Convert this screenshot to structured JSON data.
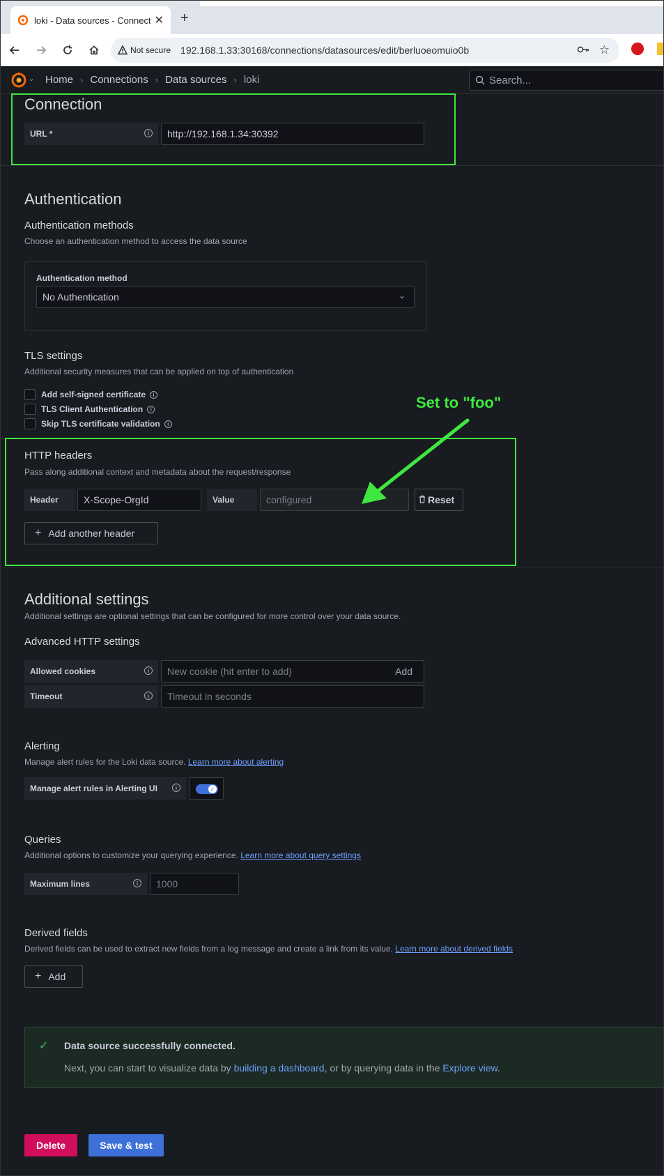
{
  "browser": {
    "tab_title": "loki - Data sources - Connection",
    "url": "192.168.1.33:30168/connections/datasources/edit/berluoeomuio0b",
    "not_secure": "Not secure"
  },
  "header": {
    "breadcrumbs": [
      "Home",
      "Connections",
      "Data sources",
      "loki"
    ],
    "search_placeholder": "Search..."
  },
  "connection": {
    "title": "Connection",
    "url_label": "URL *",
    "url_value": "http://192.168.1.34:30392"
  },
  "authentication": {
    "title": "Authentication",
    "methods_title": "Authentication methods",
    "methods_desc": "Choose an authentication method to access the data source",
    "method_label": "Authentication method",
    "method_value": "No Authentication",
    "tls_title": "TLS settings",
    "tls_desc": "Additional security measures that can be applied on top of authentication",
    "tls_options": [
      "Add self-signed certificate",
      "TLS Client Authentication",
      "Skip TLS certificate validation"
    ]
  },
  "http_headers": {
    "title": "HTTP headers",
    "desc": "Pass along additional context and metadata about the request/response",
    "header_label": "Header",
    "header_value": "X-Scope-OrgId",
    "value_label": "Value",
    "value_placeholder": "configured",
    "reset_label": "Reset",
    "add_label": "Add another header"
  },
  "annotation": "Set to \"foo\"",
  "additional": {
    "title": "Additional settings",
    "desc": "Additional settings are optional settings that can be configured for more control over your data source.",
    "advanced_title": "Advanced HTTP settings",
    "cookies_label": "Allowed cookies",
    "cookies_placeholder": "New cookie (hit enter to add)",
    "cookies_add": "Add",
    "timeout_label": "Timeout",
    "timeout_placeholder": "Timeout in seconds"
  },
  "alerting": {
    "title": "Alerting",
    "desc": "Manage alert rules for the Loki data source.",
    "link": "Learn more about alerting",
    "toggle_label": "Manage alert rules in Alerting UI",
    "toggle_on": true
  },
  "queries": {
    "title": "Queries",
    "desc": "Additional options to customize your querying experience.",
    "link": "Learn more about query settings",
    "max_lines_label": "Maximum lines",
    "max_lines_value": "1000"
  },
  "derived": {
    "title": "Derived fields",
    "desc": "Derived fields can be used to extract new fields from a log message and create a link from its value.",
    "link": "Learn more about derived fields",
    "add_label": "Add"
  },
  "alert": {
    "title": "Data source successfully connected.",
    "text_a": "Next, you can start to visualize data by ",
    "link_a": "building a dashboard",
    "text_b": ", or by querying data in the ",
    "link_b": "Explore view",
    "text_c": "."
  },
  "actions": {
    "delete": "Delete",
    "save": "Save & test"
  },
  "colors": {
    "annotation": "#3ee83e",
    "primary": "#3d71d9",
    "destructive": "#d10e5c",
    "background": "#181b1f"
  }
}
